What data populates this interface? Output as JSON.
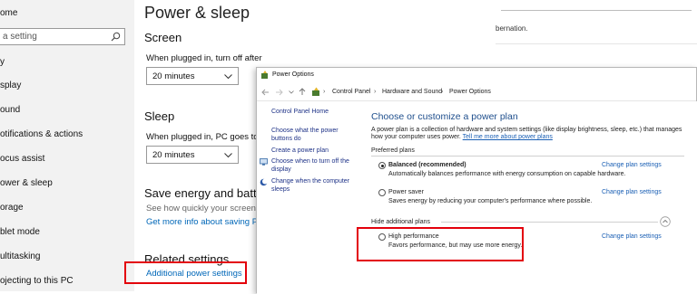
{
  "sidebar": {
    "items": [
      "ome",
      "y",
      "splay",
      "ound",
      "otifications & actions",
      "ocus assist",
      "ower & sleep",
      "orage",
      "blet mode",
      "ultitasking",
      "ojecting to this PC"
    ],
    "search_placeholder": "a setting"
  },
  "settings": {
    "title": "Power & sleep",
    "screen_heading": "Screen",
    "screen_label": "When plugged in, turn off after",
    "screen_value": "20 minutes",
    "sleep_heading": "Sleep",
    "sleep_label": "When plugged in, PC goes to sle",
    "sleep_value": "20 minutes",
    "save_heading": "Save energy and battery",
    "save_text": "See how quickly your screen goe",
    "save_link": "Get more info about saving PC e",
    "related_heading": "Related settings",
    "related_link": "Additional power settings"
  },
  "bg_window": {
    "text": "bernation."
  },
  "power_options": {
    "title": "Power Options",
    "breadcrumb": [
      "Control Panel",
      "Hardware and Sound",
      "Power Options"
    ],
    "left_links": {
      "home": "Control Panel Home",
      "buttons_1": "Choose what the power",
      "buttons_2": "buttons do",
      "create": "Create a power plan",
      "display_1": "Choose when to turn off the",
      "display_2": "display",
      "sleep_1": "Change when the computer",
      "sleep_2": "sleeps"
    },
    "heading": "Choose or customize a power plan",
    "intro_1": "A power plan is a collection of hardware and system settings (like display brightness, sleep, etc.) that manages",
    "intro_2": "how your computer uses power.",
    "intro_link": "Tell me more about power plans",
    "preferred_label": "Preferred plans",
    "hide_label": "Hide additional plans",
    "plans": [
      {
        "name": "Balanced (recommended)",
        "desc": "Automatically balances performance with energy consumption on capable hardware.",
        "action": "Change plan settings",
        "selected": true
      },
      {
        "name": "Power saver",
        "desc": "Saves energy by reducing your computer's performance where possible.",
        "action": "Change plan settings",
        "selected": false
      },
      {
        "name": "High performance",
        "desc": "Favors performance, but may use more energy.",
        "action": "Change plan settings",
        "selected": false
      }
    ]
  },
  "colors": {
    "accent": "#0067b8",
    "highlight": "#e3000b",
    "sidebar_bg": "#f2f2f2",
    "cp_heading": "#1e4e8c"
  }
}
